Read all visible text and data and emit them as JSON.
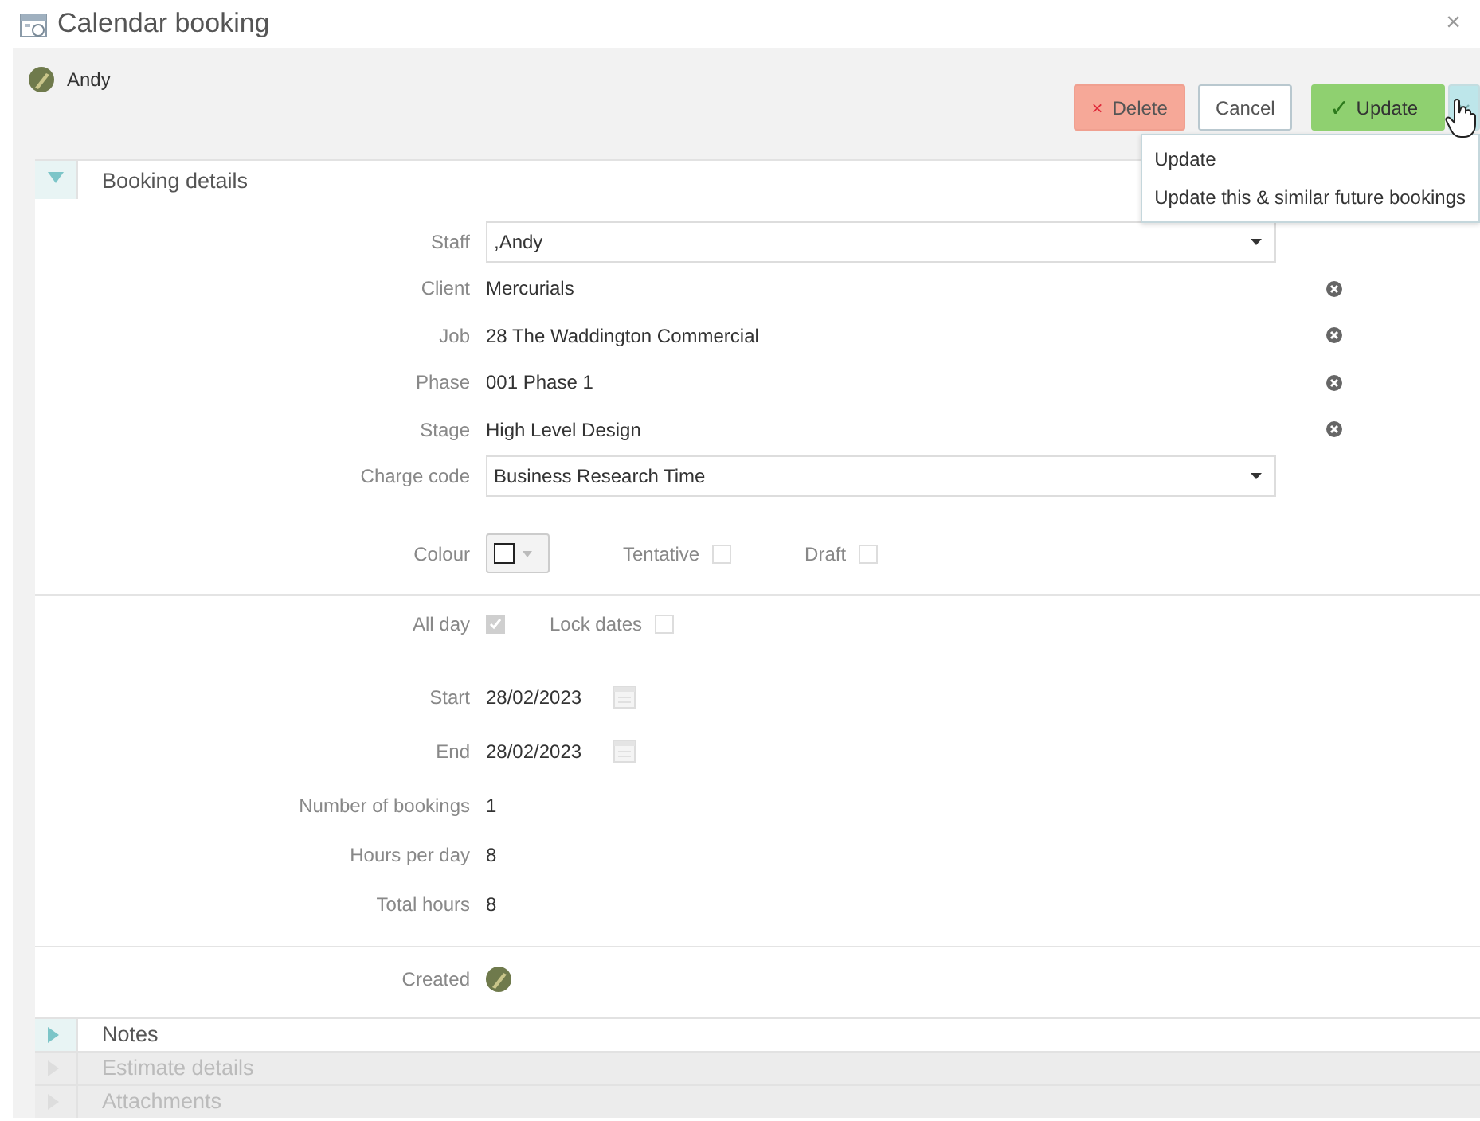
{
  "window": {
    "title": "Calendar booking",
    "close": "×"
  },
  "header": {
    "user": "Andy"
  },
  "buttons": [
    {
      "kind": "delete",
      "label": "Delete",
      "icon": "×"
    },
    {
      "kind": "cancel",
      "label": "Cancel"
    },
    {
      "kind": "update",
      "label": "Update",
      "icon": "✓"
    }
  ],
  "update_menu": {
    "expanded": true,
    "items": [
      "Update",
      "Update this & similar future bookings"
    ]
  },
  "sections": [
    {
      "title": "Booking details",
      "expanded": true,
      "disabled": false
    },
    {
      "title": "Notes",
      "expanded": false,
      "disabled": false
    },
    {
      "title": "Estimate details",
      "expanded": false,
      "disabled": true
    },
    {
      "title": "Attachments",
      "expanded": false,
      "disabled": true
    }
  ],
  "fields": [
    {
      "kind": "select",
      "label": "Staff",
      "value": ",Andy"
    },
    {
      "kind": "clearable",
      "label": "Client",
      "value": "Mercurials"
    },
    {
      "kind": "clearable",
      "label": "Job",
      "value": "28 The Waddington Commercial"
    },
    {
      "kind": "clearable",
      "label": "Phase",
      "value": "001 Phase 1"
    },
    {
      "kind": "clearable",
      "label": "Stage",
      "value": "High Level Design"
    },
    {
      "kind": "select",
      "label": "Charge code",
      "value": "Business Research Time"
    }
  ],
  "colour_row": {
    "label": "Colour",
    "checks": [
      {
        "label": "Tentative",
        "checked": false
      },
      {
        "label": "Draft",
        "checked": false
      }
    ]
  },
  "day_checks": [
    {
      "label": "All day",
      "checked": true
    },
    {
      "label": "Lock dates",
      "checked": false
    }
  ],
  "dates": [
    {
      "label": "Start",
      "value": "28/02/2023"
    },
    {
      "label": "End",
      "value": "28/02/2023"
    }
  ],
  "stats": [
    {
      "label": "Number of bookings",
      "value": "1"
    },
    {
      "label": "Hours per day",
      "value": "8"
    },
    {
      "label": "Total hours",
      "value": "8"
    }
  ],
  "created": {
    "label": "Created"
  }
}
